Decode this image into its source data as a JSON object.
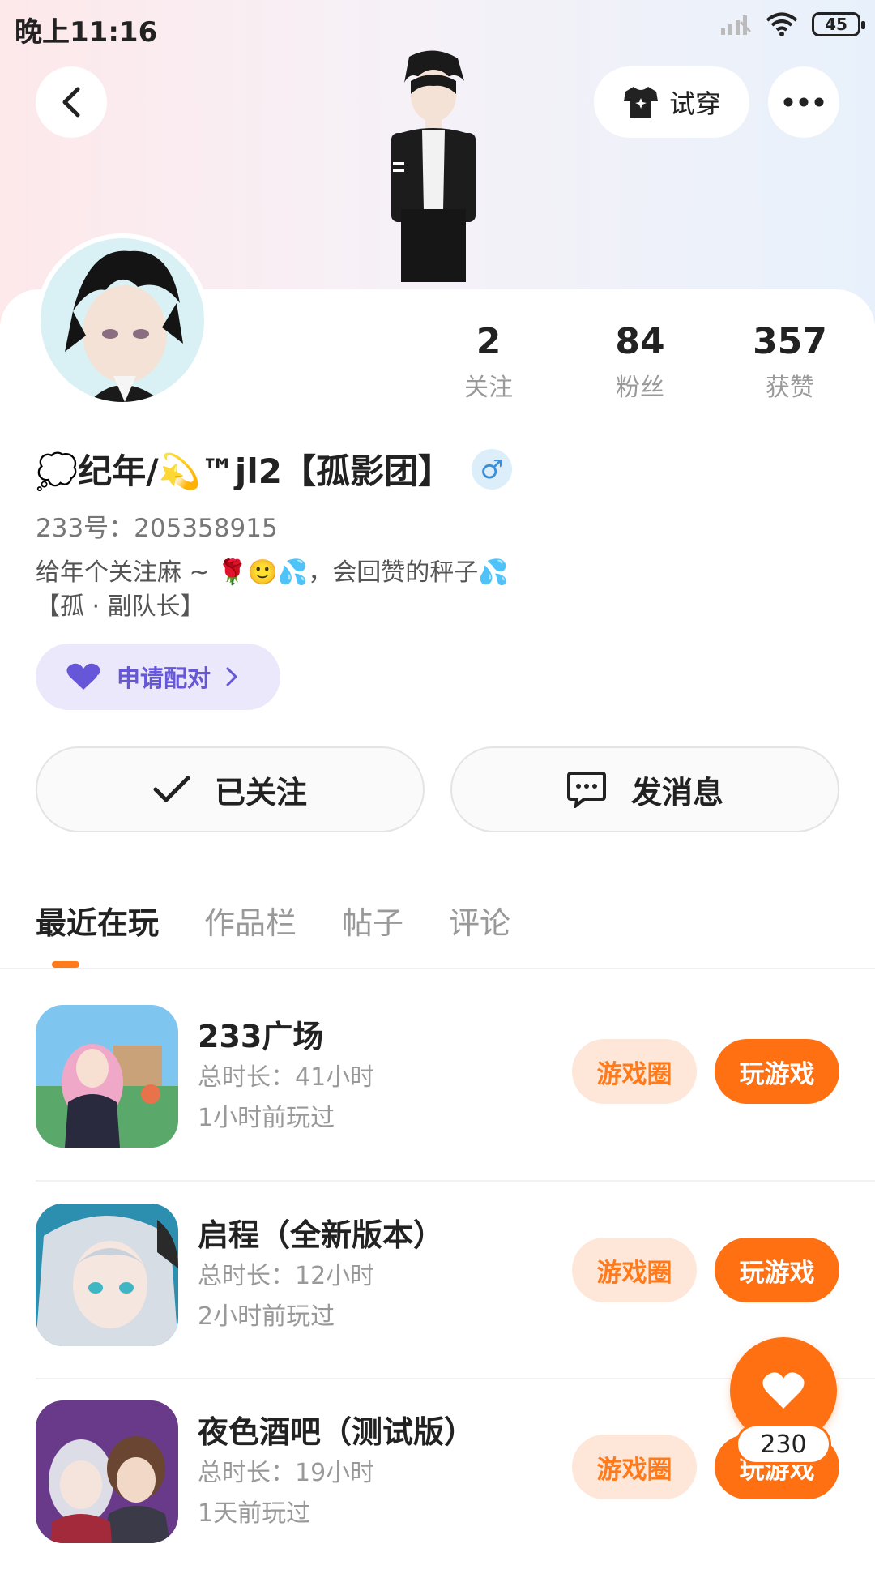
{
  "status_bar": {
    "time": "晚上11:16",
    "battery": "45"
  },
  "header": {
    "try_on_label": "试穿"
  },
  "profile": {
    "stats": [
      {
        "value": "2",
        "label": "关注"
      },
      {
        "value": "84",
        "label": "粉丝"
      },
      {
        "value": "357",
        "label": "获赞"
      }
    ],
    "name": "💭纪年/💫™jl2【孤影团】",
    "gender_symbol": "♂",
    "uid": "233号：205358915",
    "bio_line1": "给年个关注麻 ~ 🌹🙂💦，会回赞的秤子💦",
    "bio_line2": "【孤 · 副队长】",
    "pair_label": "申请配对"
  },
  "actions": {
    "follow_label": "已关注",
    "message_label": "发消息"
  },
  "tabs": [
    {
      "label": "最近在玩"
    },
    {
      "label": "作品栏"
    },
    {
      "label": "帖子"
    },
    {
      "label": "评论"
    }
  ],
  "games": [
    {
      "title": "233广场",
      "duration": "总时长：41小时",
      "last_played": "1小时前玩过",
      "circle_label": "游戏圈",
      "play_label": "玩游戏"
    },
    {
      "title": "启程（全新版本）",
      "duration": "总时长：12小时",
      "last_played": "2小时前玩过",
      "circle_label": "游戏圈",
      "play_label": "玩游戏"
    },
    {
      "title": "夜色酒吧（测试版）",
      "duration": "总时长：19小时",
      "last_played": "1天前玩过",
      "circle_label": "游戏圈",
      "play_label": "玩游戏"
    }
  ],
  "fab": {
    "count": "230"
  },
  "colors": {
    "accent": "#ff7012",
    "accent_light": "#fee6d8",
    "pair_bg": "#ebe8fc",
    "pair_text": "#6656d8"
  }
}
